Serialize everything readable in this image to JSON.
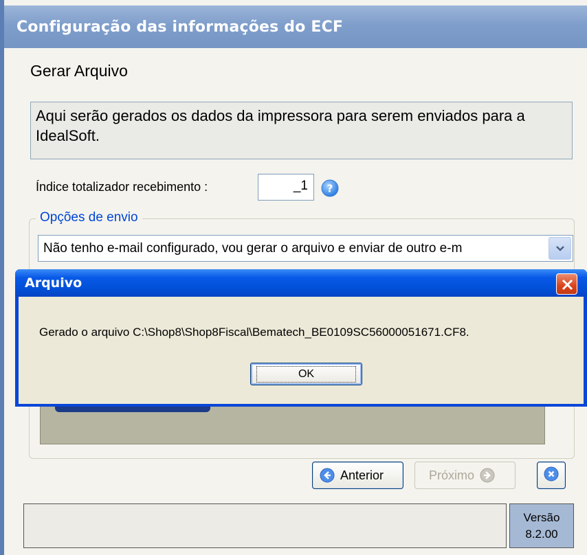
{
  "window": {
    "title": "Configuração das informações do ECF",
    "section_title": "Gerar Arquivo",
    "description": "Aqui serão gerados os dados da impressora para serem enviados para a IdealSoft.",
    "indice_label": "Índice totalizador recebimento :",
    "indice_value": "_1",
    "group_title": "Opções de envio",
    "envio_selected": "Não tenho e-mail configurado, vou gerar o arquivo e enviar de outro e-m",
    "buttons": {
      "anterior": "Anterior",
      "proximo": "Próximo"
    },
    "status": {
      "left_text": "",
      "version_label": "Versão",
      "version_value": "8.2.00"
    }
  },
  "dialog": {
    "title": "Arquivo",
    "message": "Gerado o arquivo C:\\Shop8\\Shop8Fiscal\\Bematech_BE0109SC56000051671.CF8.",
    "ok_label": "OK"
  },
  "colors": {
    "title_bar": "#7f9ecb",
    "dialog_title": "#0250d8",
    "accent_blue": "#0046d5",
    "close_red": "#d9431c"
  },
  "icons": [
    "help-icon",
    "chevron-down-icon",
    "arrow-left-icon",
    "arrow-right-icon",
    "close-icon"
  ]
}
